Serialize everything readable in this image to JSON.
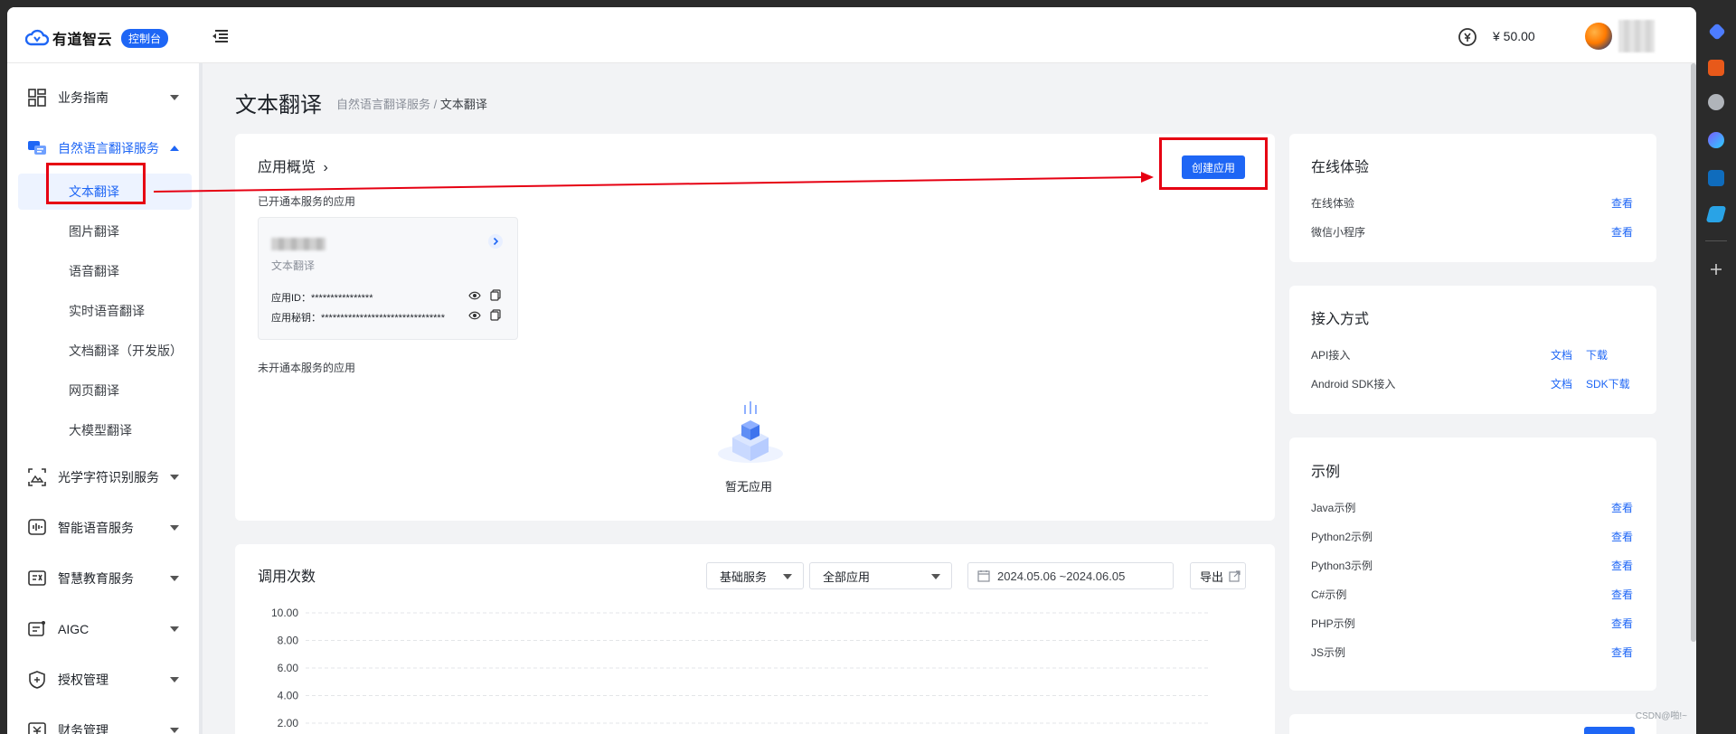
{
  "header": {
    "logo_text": "有道智云",
    "console_tag": "控制台",
    "balance": "¥ 50.00"
  },
  "sidebar": {
    "groups": [
      {
        "label": "业务指南",
        "icon": "grid-icon"
      },
      {
        "label": "自然语言翻译服务",
        "icon": "chat-translate-icon",
        "open": true
      },
      {
        "label": "光学字符识别服务",
        "icon": "image-scan-icon"
      },
      {
        "label": "智能语音服务",
        "icon": "voice-wave-icon"
      },
      {
        "label": "智慧教育服务",
        "icon": "education-icon"
      },
      {
        "label": "AIGC",
        "icon": "aigc-icon"
      },
      {
        "label": "授权管理",
        "icon": "shield-icon"
      },
      {
        "label": "财务管理",
        "icon": "finance-icon"
      }
    ],
    "sub_items": [
      {
        "label": "文本翻译",
        "active": true
      },
      {
        "label": "图片翻译"
      },
      {
        "label": "语音翻译"
      },
      {
        "label": "实时语音翻译"
      },
      {
        "label": "文档翻译（开发版）"
      },
      {
        "label": "网页翻译"
      },
      {
        "label": "大模型翻译"
      }
    ]
  },
  "page": {
    "title": "文本翻译",
    "breadcrumb_parent": "自然语言翻译服务",
    "breadcrumb_sep": " / ",
    "breadcrumb_current": "文本翻译"
  },
  "overview": {
    "title": "应用概览",
    "chevron": "›",
    "create_button": "创建应用",
    "enabled_label": "已开通本服务的应用",
    "app": {
      "service": "文本翻译",
      "id_label": "应用ID：",
      "id_value": "****************",
      "secret_label": "应用秘钥：",
      "secret_value": "********************************"
    },
    "disabled_label": "未开通本服务的应用",
    "empty_text": "暂无应用"
  },
  "calls": {
    "title": "调用次数",
    "service_select": "基础服务",
    "app_select": "全部应用",
    "date_range": "2024.05.06 ~2024.06.05",
    "export_label": "导出"
  },
  "chart_data": {
    "type": "line",
    "title": "",
    "xlabel": "",
    "ylabel": "",
    "y_ticks": [
      "10.00",
      "8.00",
      "6.00",
      "4.00",
      "2.00"
    ],
    "ylim": [
      0,
      10
    ],
    "grid": true,
    "series": []
  },
  "online": {
    "title": "在线体验",
    "rows": [
      {
        "label": "在线体验",
        "action": "查看"
      },
      {
        "label": "微信小程序",
        "action": "查看"
      }
    ]
  },
  "access": {
    "title": "接入方式",
    "rows": [
      {
        "label": "API接入",
        "doc": "文档",
        "download": "下载"
      },
      {
        "label": "Android SDK接入",
        "doc": "文档",
        "download": "SDK下载"
      }
    ]
  },
  "examples": {
    "title": "示例",
    "rows": [
      {
        "label": "Java示例",
        "action": "查看"
      },
      {
        "label": "Python2示例",
        "action": "查看"
      },
      {
        "label": "Python3示例",
        "action": "查看"
      },
      {
        "label": "C#示例",
        "action": "查看"
      },
      {
        "label": "PHP示例",
        "action": "查看"
      },
      {
        "label": "JS示例",
        "action": "查看"
      }
    ]
  },
  "watermark": "CSDN@啪!~",
  "colors": {
    "accent": "#1e66f5",
    "annotation": "#e60012"
  }
}
